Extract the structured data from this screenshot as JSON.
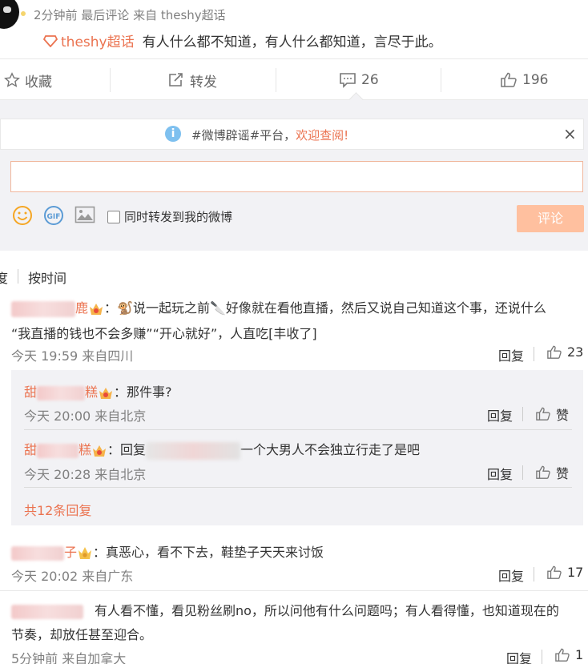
{
  "header": {
    "meta": "2分钟前 最后评论 来自 theshy超话",
    "topic_name": "theshy超话",
    "text": "有人什么都不知道，有人什么都知道，言尽于此。"
  },
  "toolbar": {
    "favorite": "收藏",
    "repost": "转发",
    "comments": "26",
    "likes": "196"
  },
  "notice": {
    "text_gray": "#微博辟谣#平台，",
    "text_orange": "欢迎查阅!",
    "close": "×"
  },
  "composer": {
    "input_value": "",
    "repost_checkbox_label": "同时转发到我的微博",
    "submit_label": "评论"
  },
  "sort": {
    "tab_partial": "度",
    "tab_time": "按时间"
  },
  "comments": [
    {
      "name_tail": "鹿",
      "text_line1": "：🐒说一起玩之前🔪好像就在看他直播，然后又说自己知道这个事，还说什么",
      "text_line2": "“我直播的钱也不会多赚”“开心就好”，人直吃[丰收了]",
      "time": "今天 19:59 来自四川",
      "reply": "回复",
      "likes": "23"
    },
    {
      "name_head": "甜",
      "name_tail": "糕",
      "text": "：那件事?",
      "time": "今天 20:00 来自北京",
      "reply": "回复",
      "likes": "赞"
    },
    {
      "name_head": "甜",
      "name_tail": "糕",
      "text_prefix": "：回复",
      "text": "一个大男人不会独立行走了是吧",
      "time": "今天 20:28 来自北京",
      "reply": "回复",
      "likes": "赞"
    },
    {
      "more": "共12条回复"
    },
    {
      "name_tail": "子",
      "text": "：真恶心，看不下去，鞋垫子天天来讨饭",
      "time": "今天 20:02 来自广东",
      "reply": "回复",
      "likes": "17"
    },
    {
      "text_line1": "有人看不懂，看见粉丝刷no，所以问他有什么问题吗；有人看得懂，也知道现在的",
      "text_line2": "节奏，却放任甚至迎合。",
      "time": "5分钟前 来自加拿大",
      "reply": "回复",
      "likes": "1"
    }
  ],
  "colors": {
    "accent": "#eb7350",
    "submit_bg": "#ffc09f",
    "reply_bg": "#f2f2f5"
  }
}
